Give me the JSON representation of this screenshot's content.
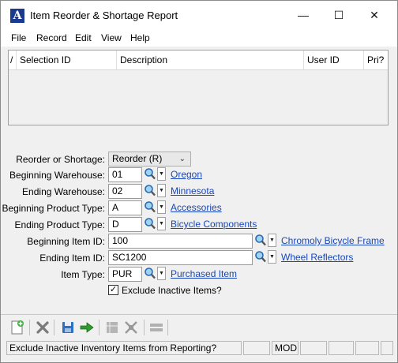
{
  "window": {
    "title": "Item Reorder & Shortage Report",
    "logo_letter": "A",
    "minimize": "—",
    "maximize": "☐",
    "close": "✕"
  },
  "menu": [
    "File",
    "Record",
    "Edit",
    "View",
    "Help"
  ],
  "grid": {
    "corner": "/",
    "columns": [
      "Selection ID",
      "Description",
      "User ID",
      "Pri?"
    ]
  },
  "form": {
    "reorder_label": "Reorder or Shortage:",
    "reorder_value": "Reorder (R)",
    "beg_wh_label": "Beginning Warehouse:",
    "beg_wh_value": "01",
    "beg_wh_link": "Oregon",
    "end_wh_label": "Ending Warehouse:",
    "end_wh_value": "02",
    "end_wh_link": "Minnesota",
    "beg_pt_label": "Beginning Product Type:",
    "beg_pt_value": "A",
    "beg_pt_link": "Accessories",
    "end_pt_label": "Ending Product Type:",
    "end_pt_value": "D",
    "end_pt_link": "Bicycle Components",
    "beg_item_label": "Beginning Item ID:",
    "beg_item_value": "100",
    "beg_item_link": "Chromoly Bicycle Frame",
    "end_item_label": "Ending Item ID:",
    "end_item_value": "SC1200",
    "end_item_link": "Wheel Reflectors",
    "item_type_label": "Item Type:",
    "item_type_value": "PUR",
    "item_type_link": "Purchased Item",
    "exclude_label": "Exclude Inactive Items?",
    "exclude_checked": "✓"
  },
  "toolbar_icons": [
    "new-icon",
    "delete-icon",
    "save-icon",
    "proceed-icon",
    "grid-icon",
    "expand-icon",
    "stack-icon"
  ],
  "status": {
    "message": "Exclude Inactive Inventory Items from Reporting?",
    "mode": "MOD"
  },
  "colors": {
    "link": "#1a47b8",
    "logo": "#1a3a8f",
    "background": "#f0f0f0"
  }
}
